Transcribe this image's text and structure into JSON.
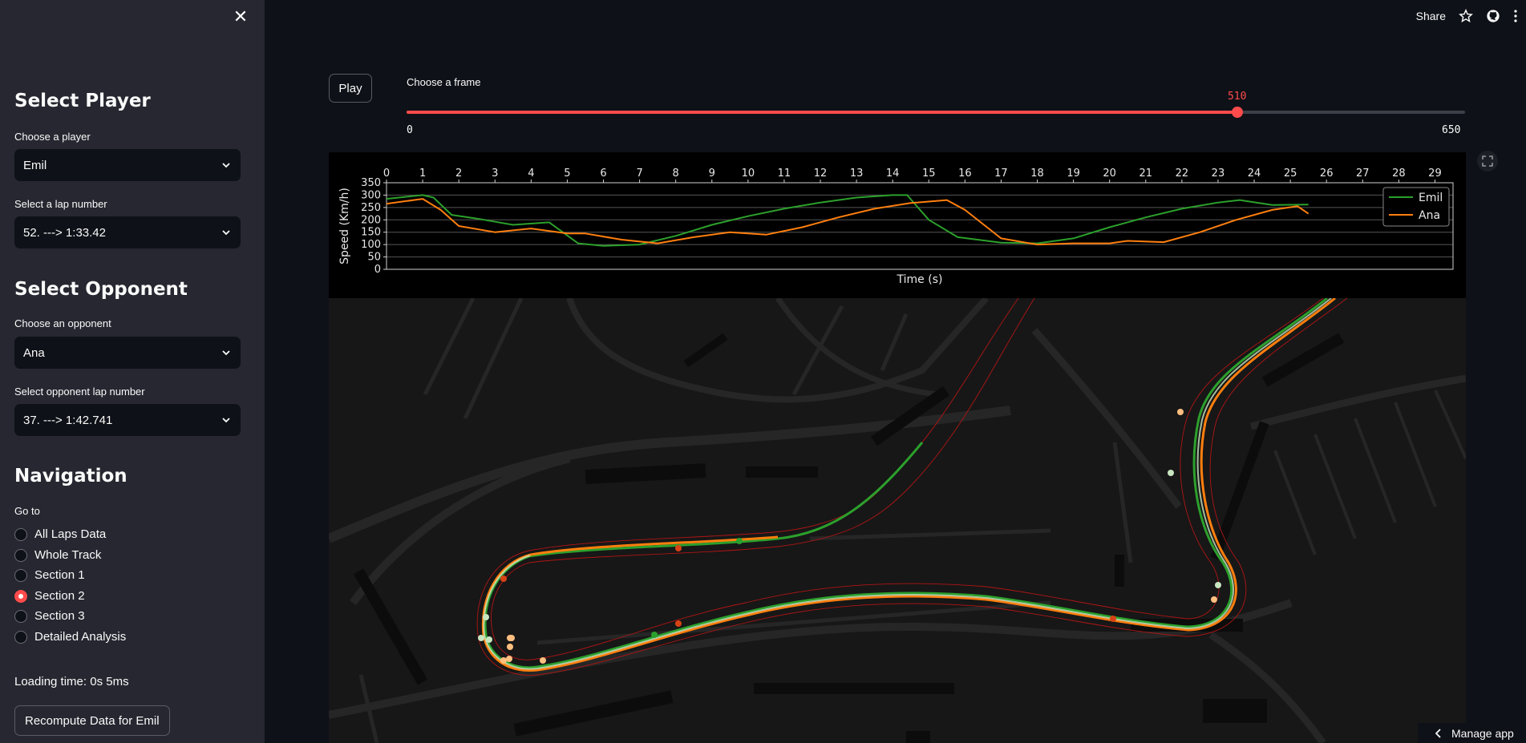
{
  "sidebar": {
    "select_player_heading": "Select Player",
    "player_label": "Choose a player",
    "player_value": "Emil",
    "lap_label": "Select a lap number",
    "lap_value": "52. ---> 1:33.42",
    "select_opponent_heading": "Select Opponent",
    "opponent_label": "Choose an opponent",
    "opponent_value": "Ana",
    "opp_lap_label": "Select opponent lap number",
    "opp_lap_value": "37. ---> 1:42.741",
    "navigation_heading": "Navigation",
    "goto_label": "Go to",
    "nav_items": [
      {
        "label": "All Laps Data",
        "selected": false
      },
      {
        "label": "Whole Track",
        "selected": false
      },
      {
        "label": "Section 1",
        "selected": false
      },
      {
        "label": "Section 2",
        "selected": true
      },
      {
        "label": "Section 3",
        "selected": false
      },
      {
        "label": "Detailed Analysis",
        "selected": false
      }
    ],
    "loading_time": "Loading time: 0s 5ms",
    "recompute_label": "Recompute Data for Emil"
  },
  "topbar": {
    "share_label": "Share"
  },
  "main": {
    "play_label": "Play",
    "frame_label": "Choose a frame",
    "slider": {
      "min": 0,
      "max": 650,
      "value": 510,
      "min_label": "0",
      "max_label": "650",
      "value_label": "510"
    }
  },
  "manage_app_label": "Manage app",
  "colors": {
    "accent": "#ff4b4b",
    "emil": "#2ca02c",
    "ana": "#ff7f0e"
  },
  "chart_data": {
    "type": "line",
    "xlabel": "Time (s)",
    "ylabel": "Speed (Km/h)",
    "xlim": [
      0,
      29.5
    ],
    "ylim": [
      0,
      350
    ],
    "xticks": [
      0,
      1,
      2,
      3,
      4,
      5,
      6,
      7,
      8,
      9,
      10,
      11,
      12,
      13,
      14,
      15,
      16,
      17,
      18,
      19,
      20,
      21,
      22,
      23,
      24,
      25,
      26,
      27,
      28,
      29
    ],
    "yticks": [
      0,
      50,
      100,
      150,
      200,
      250,
      300,
      350
    ],
    "grid": "y",
    "legend": "top-right",
    "series": [
      {
        "name": "Emil",
        "color": "#2ca02c",
        "x": [
          0,
          1,
          1.3,
          1.8,
          2.5,
          3.5,
          4.5,
          5.3,
          6,
          7,
          8,
          9,
          10,
          11,
          12,
          13,
          14,
          14.4,
          15,
          15.8,
          17,
          18,
          19,
          20,
          21,
          22,
          23,
          23.6,
          24.5,
          25.5
        ],
        "y": [
          285,
          300,
          290,
          220,
          205,
          180,
          190,
          105,
          95,
          100,
          135,
          180,
          215,
          245,
          270,
          290,
          300,
          300,
          200,
          130,
          108,
          105,
          125,
          170,
          210,
          245,
          270,
          280,
          260,
          262
        ]
      },
      {
        "name": "Ana",
        "color": "#ff7f0e",
        "x": [
          0,
          1,
          1.5,
          2,
          3,
          4,
          5,
          5.5,
          6.5,
          7.5,
          8.5,
          9.5,
          10.5,
          11.5,
          12.5,
          13.5,
          14.5,
          15.5,
          16,
          17,
          18,
          19,
          20,
          20.5,
          21.5,
          22.5,
          23.5,
          24.5,
          25.2,
          25.5
        ],
        "y": [
          265,
          285,
          240,
          175,
          150,
          165,
          145,
          145,
          120,
          105,
          130,
          150,
          140,
          170,
          210,
          245,
          268,
          280,
          240,
          125,
          100,
          105,
          105,
          115,
          110,
          150,
          200,
          240,
          255,
          225
        ]
      }
    ]
  }
}
